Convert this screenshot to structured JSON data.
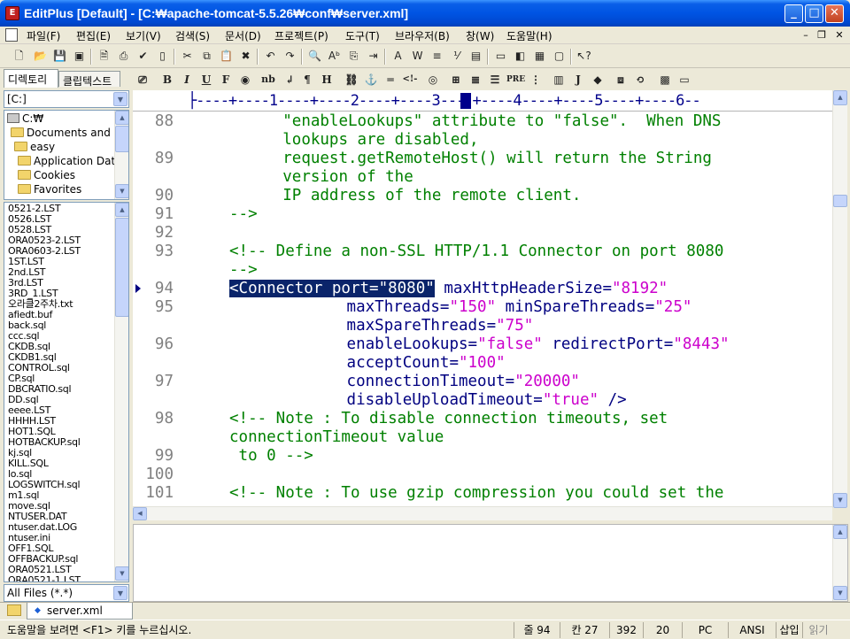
{
  "window": {
    "title": "EditPlus [Default] - [C:₩apache-tomcat-5.5.26₩conf₩server.xml]",
    "minimize": "_",
    "maximize": "□",
    "close": "✕"
  },
  "menu": [
    {
      "label": "파일(F)"
    },
    {
      "label": "편집(E)"
    },
    {
      "label": "보기(V)"
    },
    {
      "label": "검색(S)"
    },
    {
      "label": "문서(D)"
    },
    {
      "label": "프로젝트(P)"
    },
    {
      "label": "도구(T)"
    },
    {
      "label": "브라우저(B)"
    },
    {
      "label": "창(W)"
    },
    {
      "label": "도움말(H)"
    }
  ],
  "mdi": {
    "min": "–",
    "restore": "❐",
    "close": "✕"
  },
  "left_panel": {
    "tabs": [
      "디렉토리",
      "클립텍스트"
    ],
    "drive": "[C:]",
    "tree": [
      "C:₩",
      "Documents and S",
      "easy",
      "Application Data",
      "Cookies",
      "Favorites"
    ],
    "files": [
      "0521-2.LST",
      "0526.LST",
      "0528.LST",
      "ORA0523-2.LST",
      "ORA0603-2.LST",
      "1ST.LST",
      "2nd.LST",
      "3rd.LST",
      "3RD_1.LST",
      "오라클2주차.txt",
      "afiedt.buf",
      "back.sql",
      "ccc.sql",
      "CKDB.sql",
      "CKDB1.sql",
      "CONTROL.sql",
      "CP.sql",
      "DBCRATIO.sql",
      "DD.sql",
      "eeee.LST",
      "HHHH.LST",
      "HOT1.SQL",
      "HOTBACKUP.sql",
      "kj.sql",
      "KILL.SQL",
      "lo.sql",
      "LOGSWITCH.sql",
      "m1.sql",
      "move.sql",
      "NTUSER.DAT",
      "ntuser.dat.LOG",
      "ntuser.ini",
      "OFF1.SQL",
      "OFFBACKUP.sql",
      "ORA0521.LST",
      "ORA0521-1.LST"
    ],
    "filter": "All Files (*.*)"
  },
  "ruler": "├----+----1----+----2----+----3----+----4----+----5----+----6--",
  "code": [
    {
      "ln": "88",
      "parts": [
        {
          "t": "\"enableLookups\" attribute to \"false\".  When DNS",
          "c": "c-comment"
        }
      ],
      "indent": 5
    },
    {
      "ln": "",
      "parts": [
        {
          "t": "lookups are disabled,",
          "c": "c-comment"
        }
      ],
      "indent": 5
    },
    {
      "ln": "89",
      "parts": [
        {
          "t": "request.getRemoteHost() will return the String",
          "c": "c-comment"
        }
      ],
      "indent": 5
    },
    {
      "ln": "",
      "parts": [
        {
          "t": "version of the",
          "c": "c-comment"
        }
      ],
      "indent": 5
    },
    {
      "ln": "90",
      "parts": [
        {
          "t": "IP address of the remote client.",
          "c": "c-comment"
        }
      ],
      "indent": 5
    },
    {
      "ln": "91",
      "parts": [
        {
          "t": "-->",
          "c": "c-comment"
        }
      ],
      "indent": 0
    },
    {
      "ln": "92",
      "parts": [],
      "indent": 0
    },
    {
      "ln": "93",
      "parts": [
        {
          "t": "<!-- Define a non-SSL HTTP/1.1 Connector on port 8080",
          "c": "c-comment"
        }
      ],
      "indent": 0
    },
    {
      "ln": "",
      "parts": [
        {
          "t": "-->",
          "c": "c-comment"
        }
      ],
      "indent": 0
    },
    {
      "ln": "94",
      "parts": [
        {
          "t": "<Connector port=\"8080\"",
          "c": "sel"
        },
        {
          "t": " maxHttpHeaderSize=",
          "c": "c-plain"
        },
        {
          "t": "\"8192\"",
          "c": "c-str"
        }
      ],
      "indent": 0
    },
    {
      "ln": "95",
      "parts": [
        {
          "t": "maxThreads=",
          "c": "c-plain"
        },
        {
          "t": "\"150\"",
          "c": "c-str"
        },
        {
          "t": " minSpareThreads=",
          "c": "c-plain"
        },
        {
          "t": "\"25\"",
          "c": "c-str"
        }
      ],
      "indent": 11
    },
    {
      "ln": "",
      "parts": [
        {
          "t": "maxSpareThreads=",
          "c": "c-plain"
        },
        {
          "t": "\"75\"",
          "c": "c-str"
        }
      ],
      "indent": 11
    },
    {
      "ln": "96",
      "parts": [
        {
          "t": "enableLookups=",
          "c": "c-plain"
        },
        {
          "t": "\"false\"",
          "c": "c-str"
        },
        {
          "t": " redirectPort=",
          "c": "c-plain"
        },
        {
          "t": "\"8443\"",
          "c": "c-str"
        }
      ],
      "indent": 11
    },
    {
      "ln": "",
      "parts": [
        {
          "t": "acceptCount=",
          "c": "c-plain"
        },
        {
          "t": "\"100\"",
          "c": "c-str"
        }
      ],
      "indent": 11
    },
    {
      "ln": "97",
      "parts": [
        {
          "t": "connectionTimeout=",
          "c": "c-plain"
        },
        {
          "t": "\"20000\"",
          "c": "c-str"
        }
      ],
      "indent": 11
    },
    {
      "ln": "",
      "parts": [
        {
          "t": "disableUploadTimeout=",
          "c": "c-plain"
        },
        {
          "t": "\"true\"",
          "c": "c-str"
        },
        {
          "t": " />",
          "c": "c-plain"
        }
      ],
      "indent": 11
    },
    {
      "ln": "98",
      "parts": [
        {
          "t": "<!-- Note : To disable connection timeouts, set",
          "c": "c-comment"
        }
      ],
      "indent": 0
    },
    {
      "ln": "",
      "parts": [
        {
          "t": "connectionTimeout value",
          "c": "c-comment"
        }
      ],
      "indent": 0
    },
    {
      "ln": "99",
      "parts": [
        {
          "t": " to 0 -->",
          "c": "c-comment"
        }
      ],
      "indent": 0
    },
    {
      "ln": "100",
      "parts": [],
      "indent": 0
    },
    {
      "ln": "101",
      "parts": [
        {
          "t": "<!-- Note : To use gzip compression you could set the",
          "c": "c-comment"
        }
      ],
      "indent": 0
    }
  ],
  "doc_tab": "server.xml",
  "status": {
    "help": "도움말을 보려면 <F1> 키를 누르십시오.",
    "line": "줄 94",
    "col": "칸 27",
    "total": "392",
    "num": "20",
    "mode": "PC",
    "encoding": "ANSI",
    "insert": "삽입",
    "readonly": "읽기"
  },
  "colors": {
    "titlebar": "#0054e3",
    "selection": "#0a246a",
    "comment": "#008000",
    "string": "#cc00cc",
    "tag": "#000080"
  }
}
